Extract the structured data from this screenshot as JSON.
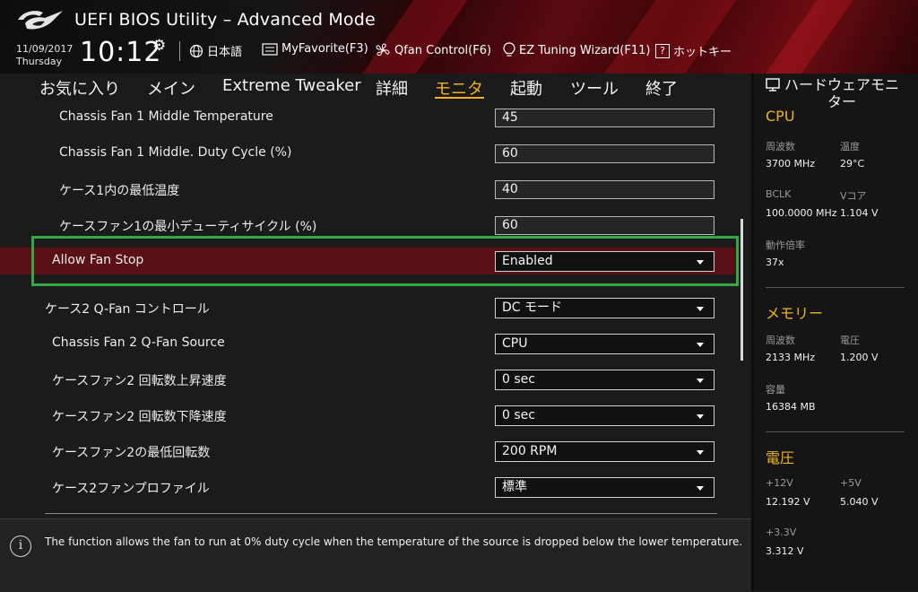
{
  "header": {
    "title": "UEFI BIOS Utility – Advanced Mode",
    "date": "11/09/2017",
    "weekday": "Thursday",
    "time": "10:12",
    "language_label": "日本語",
    "myfavorite_label": "MyFavorite(F3)",
    "qfan_label": "Qfan Control(F6)",
    "ez_tuning_label": "EZ Tuning Wizard(F11)",
    "hotkey_label": "ホットキー"
  },
  "nav": {
    "tabs": [
      {
        "label": "お気に入り"
      },
      {
        "label": "メイン"
      },
      {
        "label": "Extreme Tweaker"
      },
      {
        "label": "詳細"
      },
      {
        "label": "モニタ"
      },
      {
        "label": "起動"
      },
      {
        "label": "ツール"
      },
      {
        "label": "終了"
      }
    ],
    "active_tab": "モニタ"
  },
  "settings": [
    {
      "label": "Chassis Fan 1 Middle Temperature",
      "value": "45"
    },
    {
      "label": "Chassis Fan 1 Middle. Duty Cycle (%)",
      "value": "60"
    },
    {
      "label": "ケース1内の最低温度",
      "value": "40"
    },
    {
      "label": "ケースファン1の最小デューティサイクル (%)",
      "value": "60"
    },
    {
      "label": "Allow Fan Stop",
      "value": "Enabled"
    },
    {
      "label": "ケース2 Q-Fan コントロール",
      "value": "DC モード"
    },
    {
      "label": "Chassis Fan 2 Q-Fan Source",
      "value": "CPU"
    },
    {
      "label": "ケースファン2 回転数上昇速度",
      "value": "0 sec"
    },
    {
      "label": "ケースファン2 回転数下降速度",
      "value": "0 sec"
    },
    {
      "label": "ケースファン2の最低回転数",
      "value": "200 RPM"
    },
    {
      "label": "ケース2ファンプロファイル",
      "value": "標準"
    }
  ],
  "help": {
    "text": "The function allows the fan to run at 0% duty cycle when the temperature of the source is dropped below the lower temperature."
  },
  "hw_monitor": {
    "title": "ハードウェアモニター",
    "cpu": {
      "title": "CPU",
      "freq_label": "周波数",
      "freq_value": "3700 MHz",
      "temp_label": "温度",
      "temp_value": "29°C",
      "bclk_label": "BCLK",
      "bclk_value": "100.0000 MHz",
      "vcore_label": "Vコア",
      "vcore_value": "1.104 V",
      "ratio_label": "動作倍率",
      "ratio_value": "37x"
    },
    "memory": {
      "title": "メモリー",
      "freq_label": "周波数",
      "freq_value": "2133 MHz",
      "volt_label": "電圧",
      "volt_value": "1.200 V",
      "cap_label": "容量",
      "cap_value": "16384 MB"
    },
    "voltage": {
      "title": "電圧",
      "v12_label": "+12V",
      "v12_value": "12.192 V",
      "v5_label": "+5V",
      "v5_value": "5.040 V",
      "v33_label": "+3.3V",
      "v33_value": "3.312 V"
    }
  },
  "colors": {
    "accent": "#f0b31e",
    "highlight_row": "#5a1116",
    "selection_border": "#33a845"
  }
}
